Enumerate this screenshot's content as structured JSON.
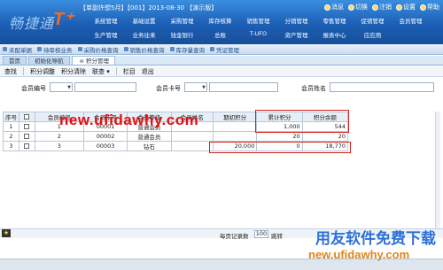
{
  "header": {
    "info": "【单副许想5月】【001】2013-08-30 【演示版】",
    "buttons": [
      {
        "label": "消息",
        "icon": "mail-icon"
      },
      {
        "label": "切换",
        "icon": "switch-icon"
      },
      {
        "label": "注销",
        "icon": "logout-icon"
      },
      {
        "label": "设置",
        "icon": "gear-icon"
      },
      {
        "label": "帮助",
        "icon": "help-icon"
      }
    ],
    "menu_row1": [
      "系统管理",
      "基础设置",
      "采购管理",
      "库存核算",
      "销售管理",
      "分销管理",
      "零售管理",
      "促销管理",
      "会员管理"
    ],
    "menu_row2": [
      "生产管理",
      "业务往来",
      "钱金银行",
      "总账",
      "T-UFO",
      "资产管理",
      "报表中心",
      "应应用"
    ]
  },
  "work_tabs": [
    "未配单据",
    "待审核业务",
    "采购价格查询",
    "销售价格查询",
    "库存量查询",
    "凭证管理"
  ],
  "page_tabs": [
    {
      "label": "首页",
      "active": false
    },
    {
      "label": "初始化导航",
      "active": false
    },
    {
      "label": "积分管理",
      "active": true
    }
  ],
  "toolbar": [
    "查找",
    "积分调整",
    "积分清除",
    "联查",
    "栏目",
    "退出"
  ],
  "filter": {
    "member_no_label": "会员编号",
    "card_no_label": "会员卡号",
    "member_name_label": "会员姓名"
  },
  "grid": {
    "headers": [
      "序号",
      "",
      "会员编号",
      "会员卡号",
      "会员等级",
      "会员姓名",
      "期初积分",
      "累计积分",
      "积分余额"
    ],
    "rows": [
      {
        "seq": "1",
        "no": "1",
        "card": "00001",
        "level": "普通会员",
        "name": "",
        "init": "",
        "total": "1,000",
        "balance": "544"
      },
      {
        "seq": "2",
        "no": "2",
        "card": "00002",
        "level": "普通会员",
        "name": "",
        "init": "",
        "total": "20",
        "balance": "20"
      },
      {
        "seq": "3",
        "no": "3",
        "card": "00003",
        "level": "钻石",
        "name": "",
        "init": "20,000",
        "total": "0",
        "balance": "18,770"
      }
    ]
  },
  "watermark_url": "new.ufidawhy.com",
  "footer": {
    "page_size_label": "每页记录数",
    "page_size_value": "100",
    "more_label": "跳转"
  },
  "brand": {
    "line1": "用友软件免费下载",
    "line2": "new.ufidawhy.com"
  },
  "colors": {
    "banner": "#1c5fb5",
    "highlight": "#d42020",
    "watermark": "#e01010"
  }
}
